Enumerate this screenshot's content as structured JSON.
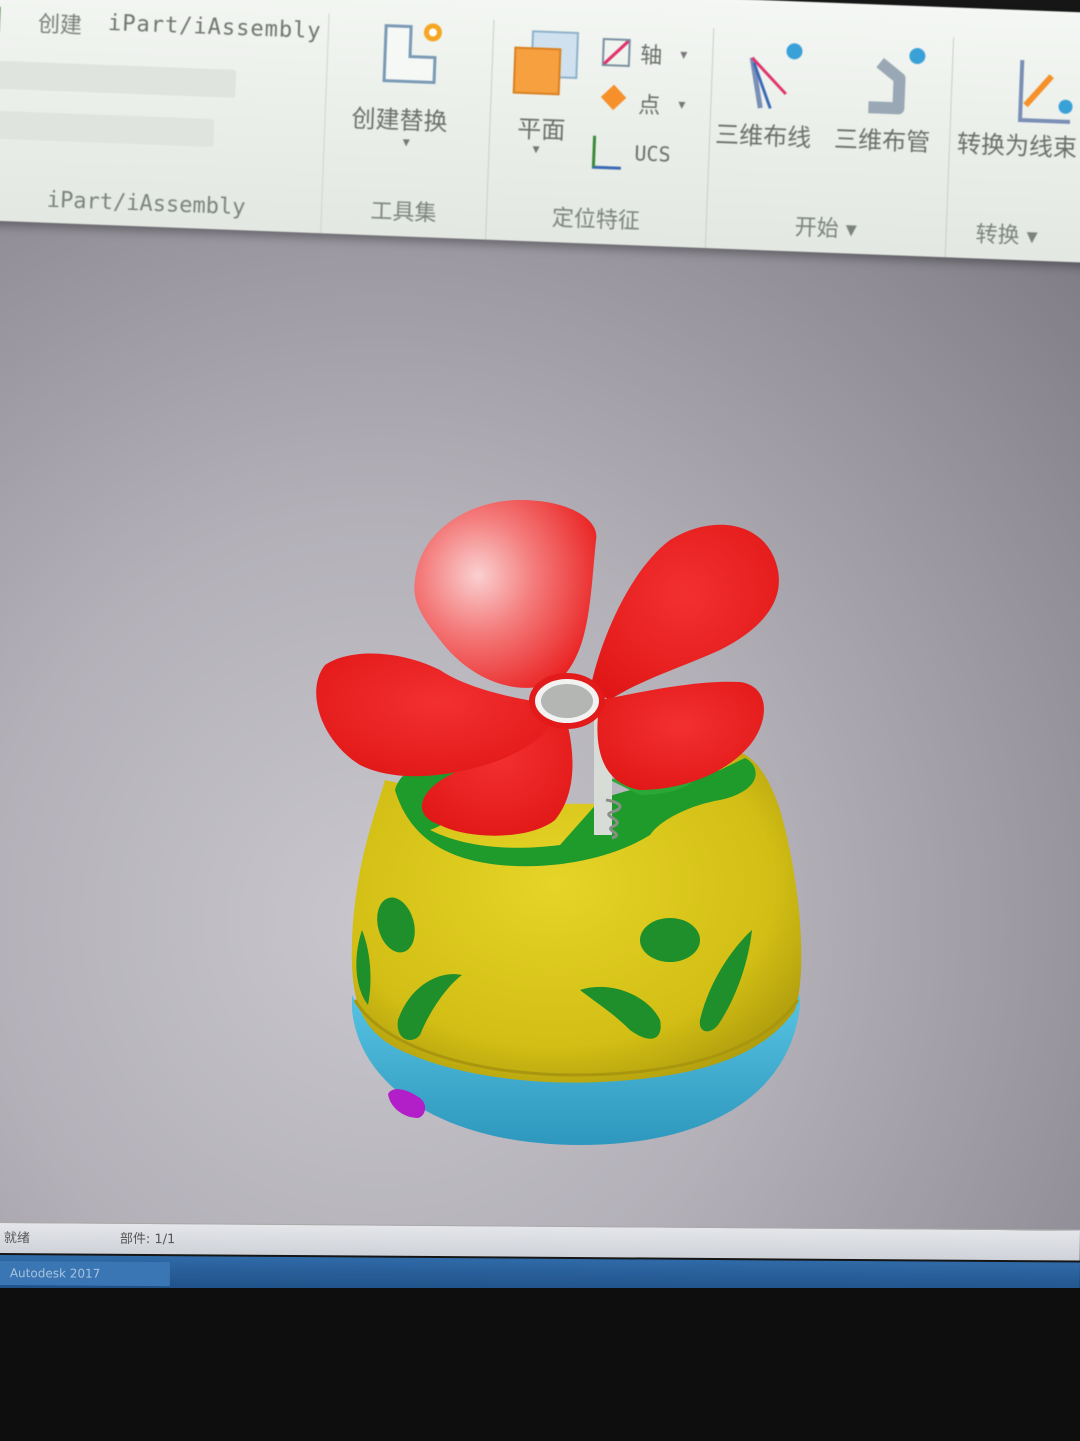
{
  "title_bar": {
    "create_label": "创建",
    "part_path": "iPart/iAssembly"
  },
  "ribbon": {
    "groups": [
      {
        "name": "iPart/iAssembly"
      },
      {
        "name": "工具集"
      },
      {
        "name": "定位特征"
      },
      {
        "name": "开始"
      },
      {
        "name": "转换"
      }
    ],
    "buttons": {
      "create_substitute": "创建替换",
      "plane": "平面",
      "axis": "轴",
      "point": "点",
      "ucs": "UCS",
      "route_3d": "三维布线",
      "pipe_3d": "三维布管",
      "convert_harness": "转换为线束"
    }
  },
  "status_bar": {
    "left_text": "就绪",
    "middle_text": "部件: 1/1"
  },
  "taskbar": {
    "item": "Autodesk 2017"
  },
  "model": {
    "colors": {
      "petals": "#ee1f1f",
      "petal_highlight": "#f7a3a3",
      "body": "#d8c418",
      "body_shadow": "#b5a30e",
      "inner_green": "#1f9a2a",
      "base": "#3fb3d6",
      "button": "#b51fc8"
    }
  }
}
